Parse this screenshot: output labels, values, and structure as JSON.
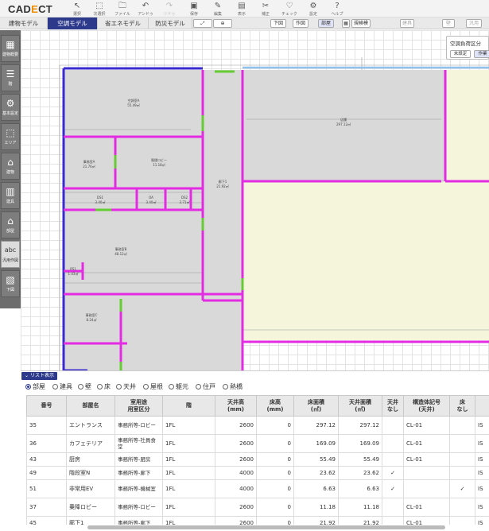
{
  "app": {
    "logo": "CADECT",
    "logo_main": "CAD",
    "logo_accent": "E",
    "logo_tail": "CT"
  },
  "toolbar": {
    "items": [
      {
        "icon": "cursor-icon",
        "glyph": "↖",
        "label": "選択"
      },
      {
        "icon": "multi-select-icon",
        "glyph": "⬚",
        "label": "次選択"
      },
      {
        "icon": "file-icon",
        "glyph": "🗀",
        "label": "ファイル"
      },
      {
        "icon": "undo-icon",
        "glyph": "↶",
        "label": "アンドゥ"
      },
      {
        "icon": "redo-icon",
        "glyph": "↷",
        "label": "リドゥ"
      },
      {
        "icon": "save-icon",
        "glyph": "▣",
        "label": "保存"
      },
      {
        "icon": "edit-icon",
        "glyph": "✎",
        "label": "編集"
      },
      {
        "icon": "display-icon",
        "glyph": "▤",
        "label": "表示"
      },
      {
        "icon": "tools-icon",
        "glyph": "✂",
        "label": "補正"
      },
      {
        "icon": "check-icon",
        "glyph": "♡",
        "label": "チェック"
      },
      {
        "icon": "settings-icon",
        "glyph": "⚙",
        "label": "設定"
      },
      {
        "icon": "help-icon",
        "glyph": "?",
        "label": "ヘルプ"
      }
    ]
  },
  "tabs": [
    {
      "label": "建物モデル",
      "active": false
    },
    {
      "label": "空調モデル",
      "active": true
    },
    {
      "label": "省エネモデル",
      "active": false
    },
    {
      "label": "防災モデル",
      "active": false
    }
  ],
  "ribbon": {
    "down_label": "下図",
    "draw_label": "作図",
    "room_label": "部屋",
    "mark_label": "規検模",
    "fitting_label": "建具",
    "wall_label": "壁",
    "wide_label": "汎用"
  },
  "sidebar": [
    {
      "icon": "building-info-icon",
      "glyph": "▦",
      "label": "建物概要"
    },
    {
      "icon": "floor-icon",
      "glyph": "☰",
      "label": "階"
    },
    {
      "icon": "gear-icon",
      "glyph": "⚙",
      "label": "基本設定"
    },
    {
      "icon": "area-icon",
      "glyph": "⬚",
      "label": "エリア"
    },
    {
      "icon": "building-icon",
      "glyph": "⌂",
      "label": "建物"
    },
    {
      "icon": "fitting-icon",
      "glyph": "▥",
      "label": "建具"
    },
    {
      "icon": "room-icon",
      "glyph": "⌂",
      "label": "部屋"
    },
    {
      "icon": "text-icon",
      "glyph": "abc",
      "label": "汎用作図"
    },
    {
      "icon": "underlay-icon",
      "glyph": "▧",
      "label": "下図"
    }
  ],
  "rooms": [
    {
      "name": "空調室A",
      "area": "55.49㎡"
    },
    {
      "name": "店舗",
      "area": "297.12㎡"
    },
    {
      "name": "事務室A",
      "area": "21.76㎡"
    },
    {
      "name": "喫煙ロビー",
      "area": "11.18㎡"
    },
    {
      "name": "廊下1",
      "area": "21.92㎡"
    },
    {
      "name": "DS1",
      "area": "3.40㎡"
    },
    {
      "name": "OA",
      "area": "3.40㎡"
    },
    {
      "name": "DS2",
      "area": "3.71㎡"
    },
    {
      "name": "事務室B",
      "area": "48.12㎡"
    },
    {
      "name": "PS1",
      "area": "1.43㎡"
    },
    {
      "name": "事務室C",
      "area": "8.24㎡"
    }
  ],
  "hvac_panel": {
    "title": "空調負荷区分",
    "unset_label": "未設定",
    "work_label": "作業"
  },
  "list": {
    "toggle_label": "リスト表示",
    "filters": [
      {
        "label": "部屋",
        "selected": true
      },
      {
        "label": "建具",
        "selected": false
      },
      {
        "label": "壁",
        "selected": false
      },
      {
        "label": "床",
        "selected": false
      },
      {
        "label": "天井",
        "selected": false
      },
      {
        "label": "屋根",
        "selected": false
      },
      {
        "label": "躯元",
        "selected": false
      },
      {
        "label": "住戸",
        "selected": false
      },
      {
        "label": "熱橋",
        "selected": false
      }
    ],
    "columns": [
      "番号",
      "部屋名",
      "室用途\n用室区分",
      "階",
      "天井高\n(mm)",
      "床高\n(mm)",
      "床面積\n(㎡)",
      "天井面積\n(㎡)",
      "天井\nなし",
      "構造体記号\n(天井)",
      "床\nなし",
      ""
    ],
    "rows": [
      {
        "no": "35",
        "name": "エントランス",
        "usage": "事務所等-ロビー",
        "floor": "1FL",
        "ceil_h": "2600",
        "floor_h": "0",
        "area": "297.12",
        "ceil_area": "297.12",
        "no_ceil": "",
        "struct": "CL-01",
        "no_floor": "",
        "extra": "IS"
      },
      {
        "no": "36",
        "name": "カフェテリア",
        "usage": "事務所等-社員食堂",
        "floor": "1FL",
        "ceil_h": "2600",
        "floor_h": "0",
        "area": "169.09",
        "ceil_area": "169.09",
        "no_ceil": "",
        "struct": "CL-01",
        "no_floor": "",
        "extra": "IS"
      },
      {
        "no": "43",
        "name": "厨房",
        "usage": "事務所等-厨房",
        "floor": "1FL",
        "ceil_h": "2600",
        "floor_h": "0",
        "area": "55.49",
        "ceil_area": "55.49",
        "no_ceil": "",
        "struct": "CL-01",
        "no_floor": "",
        "extra": "IS"
      },
      {
        "no": "49",
        "name": "階段室N",
        "usage": "事務所等-廊下",
        "floor": "1FL",
        "ceil_h": "4000",
        "floor_h": "0",
        "area": "23.62",
        "ceil_area": "23.62",
        "no_ceil": "✓",
        "struct": "",
        "no_floor": "",
        "extra": "IS"
      },
      {
        "no": "51",
        "name": "非常用EV",
        "usage": "事務所等-機械室",
        "floor": "1FL",
        "ceil_h": "4000",
        "floor_h": "0",
        "area": "6.63",
        "ceil_area": "6.63",
        "no_ceil": "✓",
        "struct": "",
        "no_floor": "✓",
        "extra": "IS"
      },
      {
        "no": "37",
        "name": "乗降ロビー",
        "usage": "事務所等-ロビー",
        "floor": "1FL",
        "ceil_h": "2600",
        "floor_h": "0",
        "area": "11.18",
        "ceil_area": "11.18",
        "no_ceil": "",
        "struct": "CL-01",
        "no_floor": "",
        "extra": "IS"
      },
      {
        "no": "45",
        "name": "廊下1",
        "usage": "事務所等-廊下",
        "floor": "1FL",
        "ceil_h": "2600",
        "floor_h": "0",
        "area": "21.92",
        "ceil_area": "21.92",
        "no_ceil": "",
        "struct": "CL-01",
        "no_floor": "",
        "extra": "IS"
      }
    ]
  },
  "colors": {
    "accent": "#2d3a8c",
    "wall_magenta": "#e22be2",
    "wall_blue": "#3a2bd0",
    "door_green": "#66cc33",
    "room_gray": "#d9d9d9",
    "room_cream": "#f5f5dc",
    "logo_orange": "#f08c00"
  }
}
